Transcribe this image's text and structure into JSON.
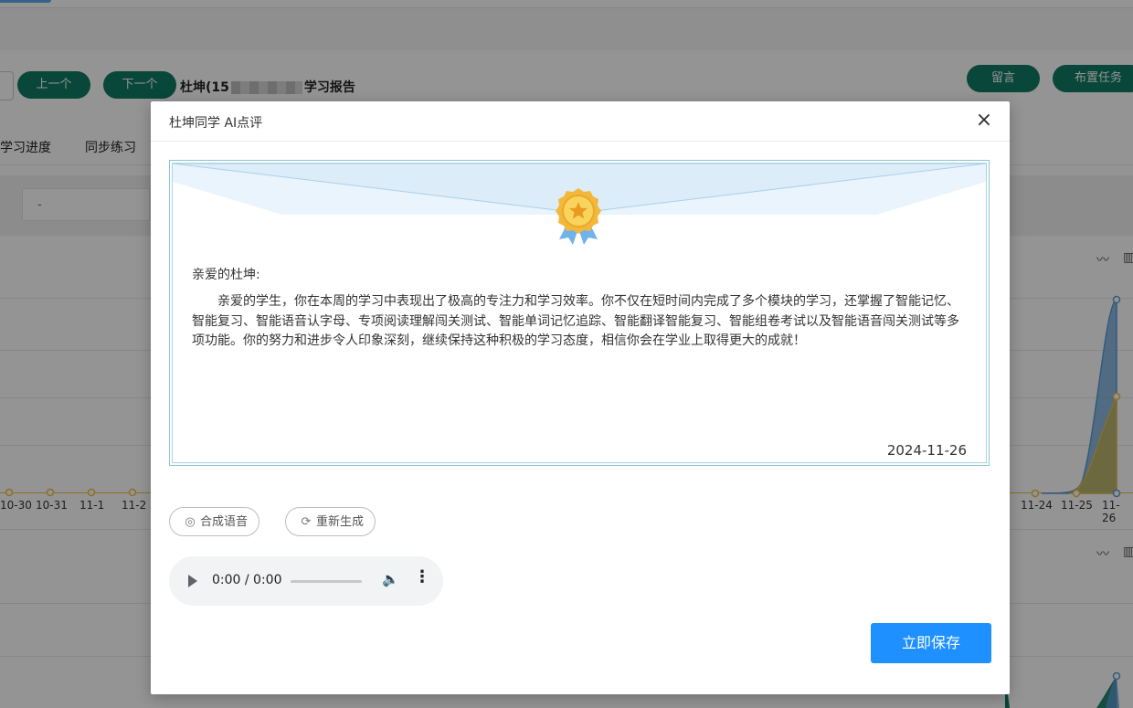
{
  "background": {
    "nav": {
      "prev_label": "上一个",
      "next_label": "下一个"
    },
    "report_title_prefix": "杜坤(15",
    "report_title_suffix": "学习报告",
    "actions": {
      "message_label": "留言",
      "assign_label": "布置任务"
    },
    "tabs": [
      "学习进度",
      "同步练习"
    ],
    "filter_value": "-",
    "x_axis_left": [
      "10-30",
      "10-31",
      "11-1",
      "11-2"
    ],
    "x_axis_right": [
      "11-24",
      "11-25",
      "11-26"
    ],
    "colors": {
      "primary_green": "#0f7a63",
      "series_blue": "#5b9bd5",
      "series_yellow": "#f0c040"
    }
  },
  "dialog": {
    "title": "杜坤同学 AI点评",
    "close_icon": "close-icon",
    "letter": {
      "greeting": "亲爱的杜坤:",
      "body": "亲爱的学生，你在本周的学习中表现出了极高的专注力和学习效率。你不仅在短时间内完成了多个模块的学习，还掌握了智能记忆、智能复习、智能语音认字母、专项阅读理解闯关测试、智能单词记忆追踪、智能翻译智能复习、智能组卷考试以及智能语音闯关测试等多项功能。你的努力和进步令人印象深刻，继续保持这种积极的学习态度，相信你会在学业上取得更大的成就！",
      "date": "2024-11-26"
    },
    "buttons": {
      "synthesize_label": "合成语音",
      "regenerate_label": "重新生成",
      "save_label": "立即保存"
    },
    "audio": {
      "time_display": "0:00 / 0:00"
    },
    "colors": {
      "save_blue": "#1e90ff"
    }
  }
}
